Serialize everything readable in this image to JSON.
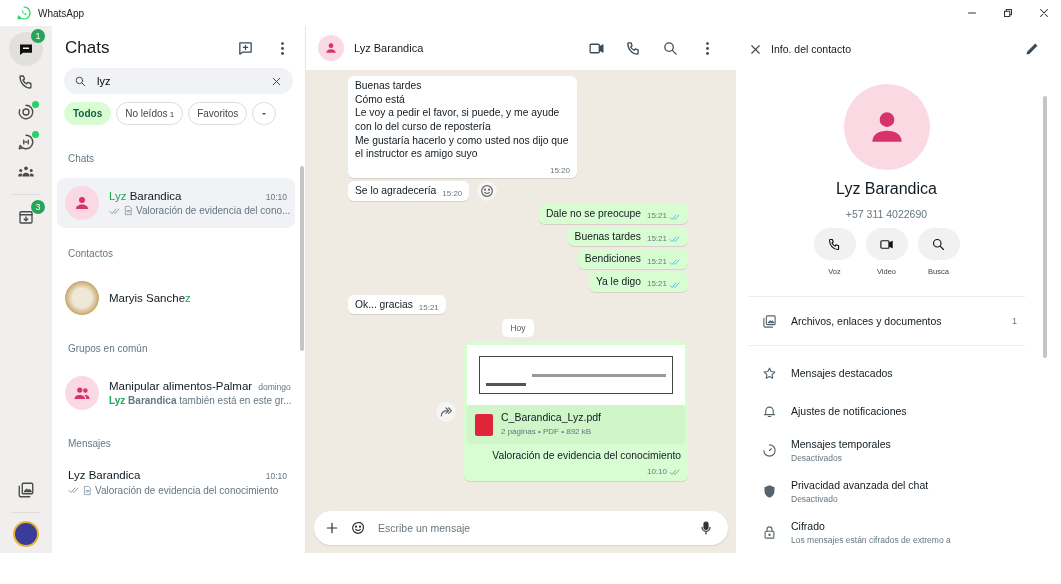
{
  "window": {
    "title": "WhatsApp"
  },
  "rail": {
    "top": [
      {
        "kind": "chats",
        "badge": "1",
        "dot": false,
        "selected": true
      },
      {
        "kind": "calls",
        "dot": false,
        "selected": false
      },
      {
        "kind": "status",
        "dot": true,
        "selected": false
      },
      {
        "kind": "channels",
        "dot": true,
        "selected": false
      },
      {
        "kind": "communities",
        "dot": false,
        "selected": false
      },
      {
        "kind": "archive",
        "badge": "3",
        "dot": false,
        "selected": false
      }
    ],
    "bottom": [
      {
        "kind": "media"
      },
      {
        "kind": "profile"
      }
    ]
  },
  "chat_list": {
    "title": "Chats",
    "search": {
      "value": "lyz"
    },
    "filters": [
      {
        "label": "Todos",
        "selected": true
      },
      {
        "label": "No leídos",
        "count": "1",
        "selected": false
      },
      {
        "label": "Favoritos",
        "selected": false
      },
      {
        "kind": "dropdown",
        "selected": false
      }
    ],
    "sections": [
      {
        "heading": "Chats",
        "items": [
          {
            "kind": "person_chat",
            "name": [
              {
                "text": "Lyz",
                "highlight": true
              },
              {
                "text": " Barandica",
                "highlight": false
              }
            ],
            "time": "10:10",
            "read": false,
            "preview": [
              {
                "text": "Valoración de evidencia del cono...",
                "highlight": false
              }
            ],
            "selected": true
          }
        ]
      },
      {
        "heading": "Contactos",
        "items": [
          {
            "kind": "contact",
            "name": [
              {
                "text": "Maryis Sanche",
                "highlight": false
              },
              {
                "text": "z",
                "highlight": true
              }
            ],
            "selected": false
          }
        ]
      },
      {
        "heading": "Grupos en común",
        "items": [
          {
            "kind": "group_chat",
            "name": [
              {
                "text": "Manipular alimentos-Palmar",
                "highlight": false
              }
            ],
            "time": "domingo",
            "preview": [
              {
                "text": "**Lyz**",
                "highlight": true
              },
              {
                "text": " **Barandica** también está en este gr...",
                "highlight": false
              }
            ],
            "selected": false
          }
        ]
      },
      {
        "heading": "Mensajes",
        "items": [
          {
            "kind": "message",
            "name": [
              {
                "text": "Lyz Barandica",
                "highlight": false
              }
            ],
            "time": "10:10",
            "read": false,
            "preview": [
              {
                "text": "Valoración de evidencia del conocimiento",
                "highlight": false
              }
            ],
            "selected": false
          }
        ]
      }
    ]
  },
  "chat": {
    "name": "Lyz Barandica",
    "composer": {
      "placeholder": "Escribe un mensaje"
    },
    "messages": [
      {
        "kind": "in",
        "text": "Buenas tardes\nCómo está\nLe voy a pedir el favor, si puede, y me ayude con lo del curso de repostería\nMe gustaría hacerlo  y como usted nos dijo que el instructor es amigo suyo",
        "time": "15:20"
      },
      {
        "kind": "in",
        "text": "Se lo agradecería",
        "time": "15:20",
        "reaction_button": true
      },
      {
        "kind": "out",
        "text": "Dale no se preocupe",
        "time": "15:21",
        "read": true
      },
      {
        "kind": "out",
        "text": "Buenas tardes",
        "time": "15:21",
        "read": true
      },
      {
        "kind": "out",
        "text": "Bendiciones",
        "time": "15:21",
        "read": true
      },
      {
        "kind": "out",
        "text": "Ya le digo",
        "time": "15:21",
        "read": true
      },
      {
        "kind": "in",
        "text": "Ok... gracias",
        "time": "15:21"
      },
      {
        "kind": "date",
        "text": "Hoy"
      },
      {
        "kind": "document",
        "file": "C_Barandica_Lyz.pdf",
        "meta": "2 páginas • PDF • 892 kB",
        "text": "Valoración de evidencia del conocimiento",
        "time": "10:10",
        "read": false,
        "forward_button": true
      }
    ]
  },
  "info": {
    "title": "Info. del contacto",
    "name": "Lyz Barandica",
    "phone": "+57 311 4022690",
    "actions": [
      {
        "kind": "voice",
        "label": "Voz"
      },
      {
        "kind": "video",
        "label": "Video"
      },
      {
        "kind": "search",
        "label": "Busca"
      }
    ],
    "media": {
      "label": "Archivos, enlaces y documentos",
      "count": "1"
    },
    "options": [
      {
        "kind": "starred",
        "title": "Mensajes destacados"
      },
      {
        "kind": "notifications",
        "title": "Ajustes de notificaciones"
      },
      {
        "kind": "disappearing",
        "title": "Mensajes temporales",
        "subtitle": "Desactivados"
      },
      {
        "kind": "privacy",
        "title": "Privacidad avanzada del chat",
        "subtitle": "Desactivado"
      },
      {
        "kind": "encryption",
        "title": "Cifrado",
        "subtitle": "Los mensajes están cifrados de extremo a"
      }
    ]
  }
}
